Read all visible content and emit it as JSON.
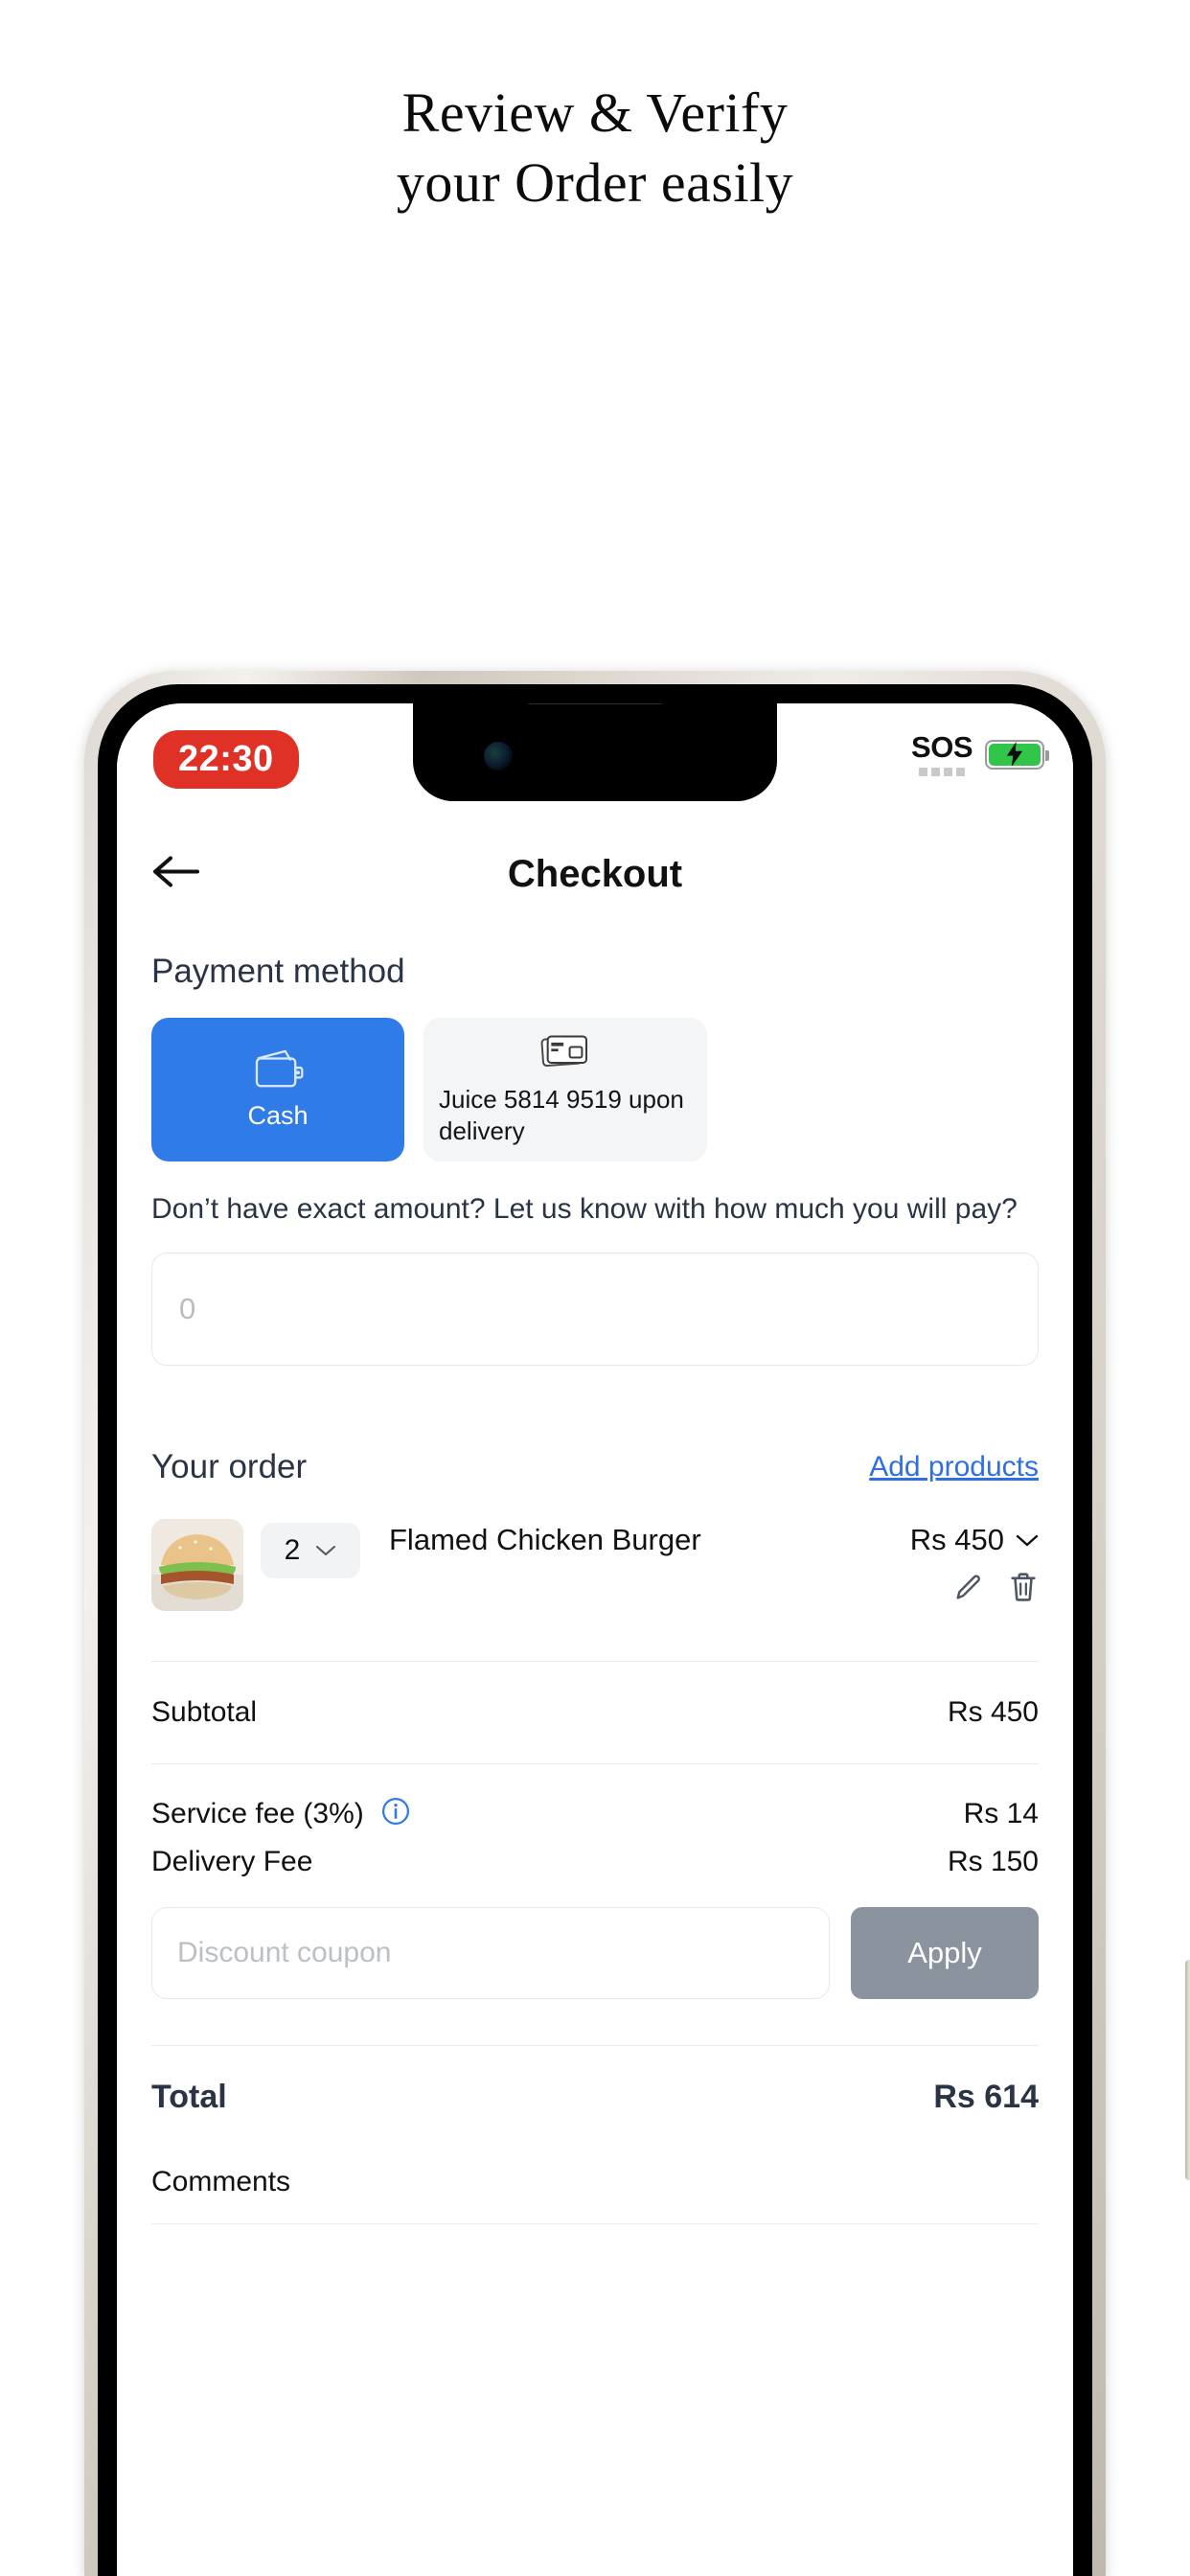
{
  "promo": {
    "line1": "Review & Verify",
    "line2": "your Order easily"
  },
  "status_bar": {
    "time": "22:30",
    "time_pill_color": "#e03127",
    "carrier": "SOS",
    "battery_color": "#31c54a",
    "battery_charging": true
  },
  "header": {
    "back_icon": "arrow-left-icon",
    "title": "Checkout"
  },
  "payment": {
    "section_title": "Payment method",
    "options": [
      {
        "id": "cash",
        "label": "Cash",
        "icon": "wallet-icon",
        "selected": true,
        "color": "#2f7be8"
      },
      {
        "id": "juice",
        "label": "Juice  5814 9519 upon delivery",
        "icon": "credit-card-icon",
        "selected": false,
        "color": "#f4f5f6"
      }
    ],
    "note": "Don’t have exact amount? Let us know with how much you will pay?",
    "amount_placeholder": "0",
    "amount_value": ""
  },
  "order": {
    "section_title": "Your order",
    "add_products_label": "Add products",
    "items": [
      {
        "name": "Flamed Chicken Burger",
        "qty": "2",
        "price": "Rs 450",
        "thumb": "burger-photo",
        "edit_icon": "pencil-icon",
        "delete_icon": "trash-icon",
        "expand_icon": "chevron-down-icon"
      }
    ]
  },
  "summary": {
    "subtotal_label": "Subtotal",
    "subtotal_value": "Rs 450",
    "service_fee_label": "Service fee (3%)",
    "service_fee_value": "Rs 14",
    "service_fee_info_icon": "info-icon",
    "delivery_fee_label": "Delivery Fee",
    "delivery_fee_value": "Rs 150",
    "total_label": "Total",
    "total_value": "Rs 614"
  },
  "coupon": {
    "placeholder": "Discount coupon",
    "value": "",
    "apply_label": "Apply",
    "apply_color": "#8b939f"
  },
  "comments": {
    "label": "Comments"
  }
}
